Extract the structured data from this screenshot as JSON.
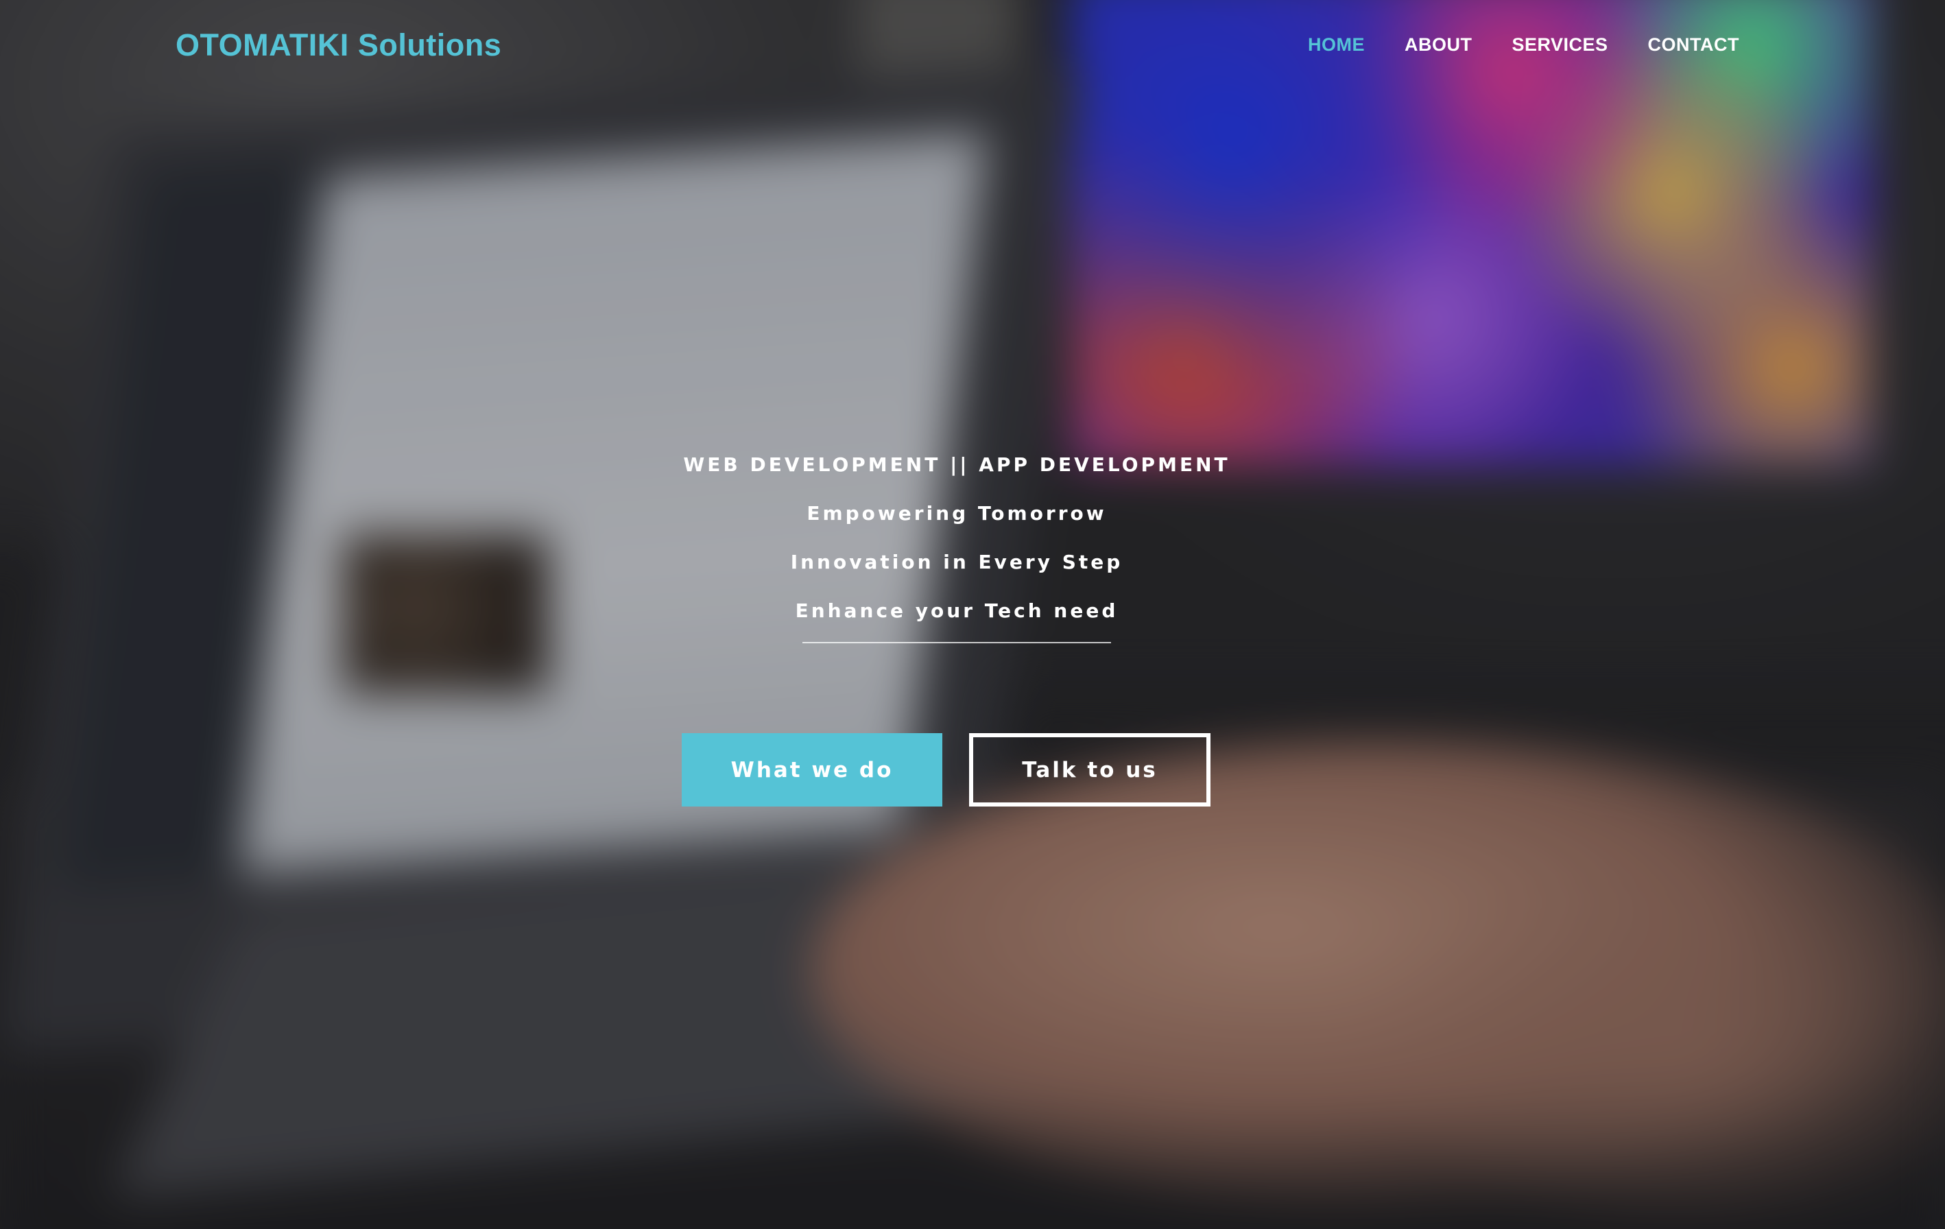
{
  "brand": {
    "name": "OTOMATIKI Solutions",
    "color": "#55c3d6"
  },
  "nav": {
    "items": [
      {
        "label": "HOME",
        "active": true
      },
      {
        "label": "ABOUT",
        "active": false
      },
      {
        "label": "SERVICES",
        "active": false
      },
      {
        "label": "CONTACT",
        "active": false
      }
    ]
  },
  "hero": {
    "tagline": "WEB DEVELOPMENT || APP DEVELOPMENT",
    "lines": [
      "Empowering Tomorrow",
      "Innovation in Every Step",
      "Enhance your Tech need"
    ],
    "primary_button": "What we do",
    "secondary_button": "Talk to us"
  },
  "colors": {
    "accent": "#55c3d6",
    "text": "#ffffff"
  }
}
